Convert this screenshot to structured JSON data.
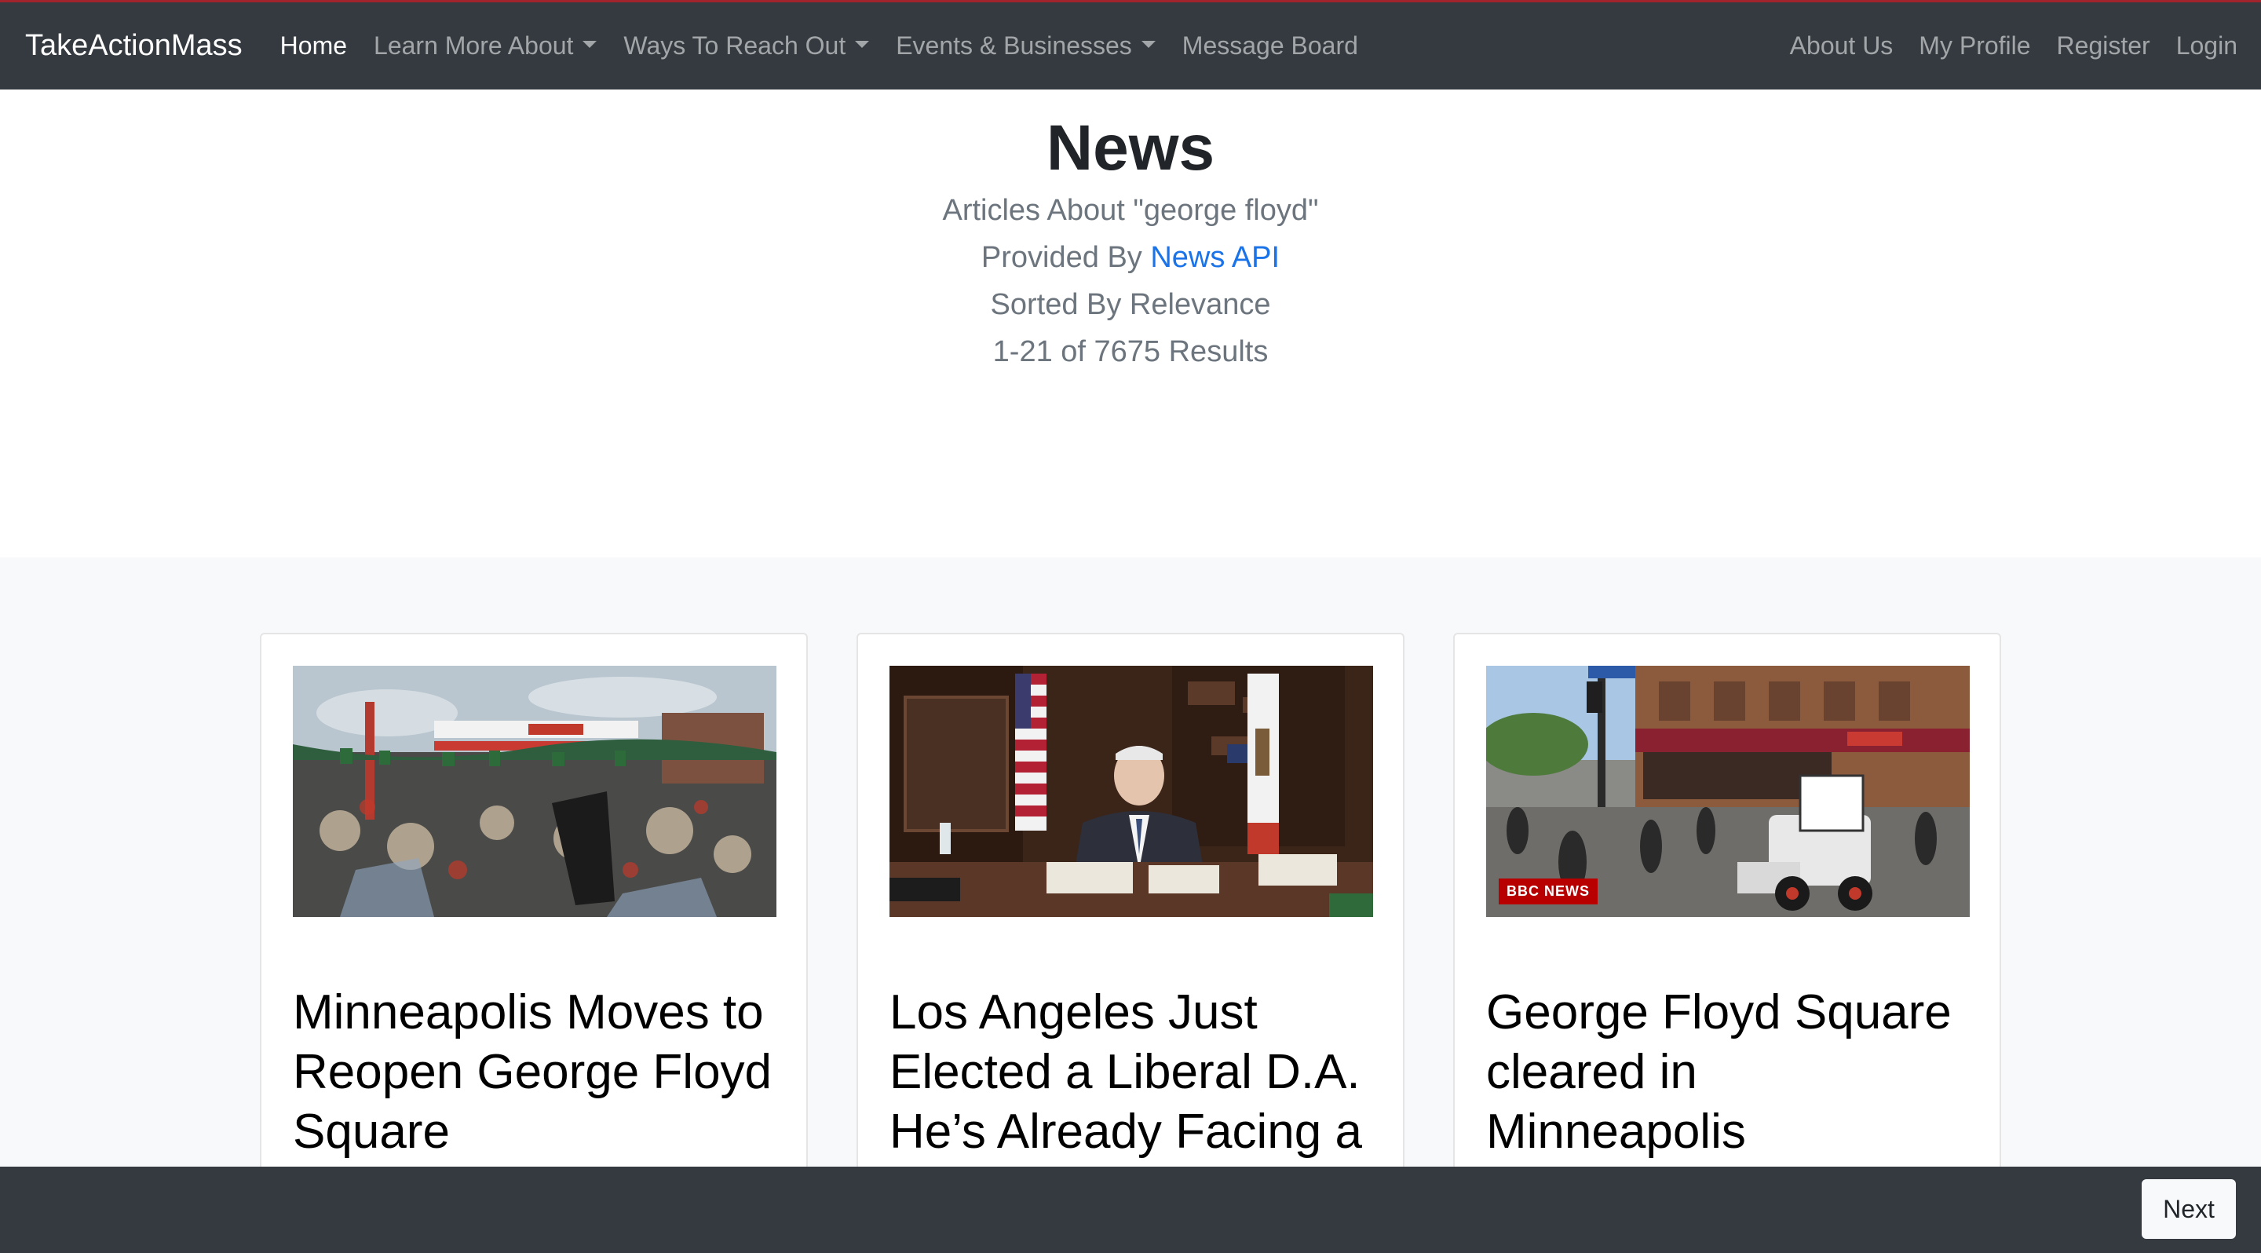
{
  "nav": {
    "brand": "TakeActionMass",
    "home": "Home",
    "learn_more": "Learn More About",
    "ways_to_reach_out": "Ways To Reach Out",
    "events_businesses": "Events & Businesses",
    "message_board": "Message Board",
    "about_us": "About Us",
    "my_profile": "My Profile",
    "register": "Register",
    "login": "Login"
  },
  "hero": {
    "title": "News",
    "articles_about": "Articles About \"george floyd\"",
    "provided_by_prefix": "Provided By ",
    "provided_by_link": "News API",
    "sorted_by": "Sorted By Relevance",
    "results": "1-21 of 7675 Results"
  },
  "cards": [
    {
      "title": "Minneapolis Moves to Reopen George Floyd Square",
      "image": "memorial-square-photo"
    },
    {
      "title": "Los Angeles Just Elected a Liberal D.A. He’s Already Facing a",
      "image": "official-at-desk-photo"
    },
    {
      "title": "George Floyd Square cleared in Minneapolis",
      "image": "street-bulldozer-photo",
      "badge": "BBC NEWS"
    }
  ],
  "footer": {
    "next_label": "Next"
  },
  "colors": {
    "navbar": "#343a40",
    "link": "#1a73e8",
    "album_bg": "#f8f9fa"
  }
}
